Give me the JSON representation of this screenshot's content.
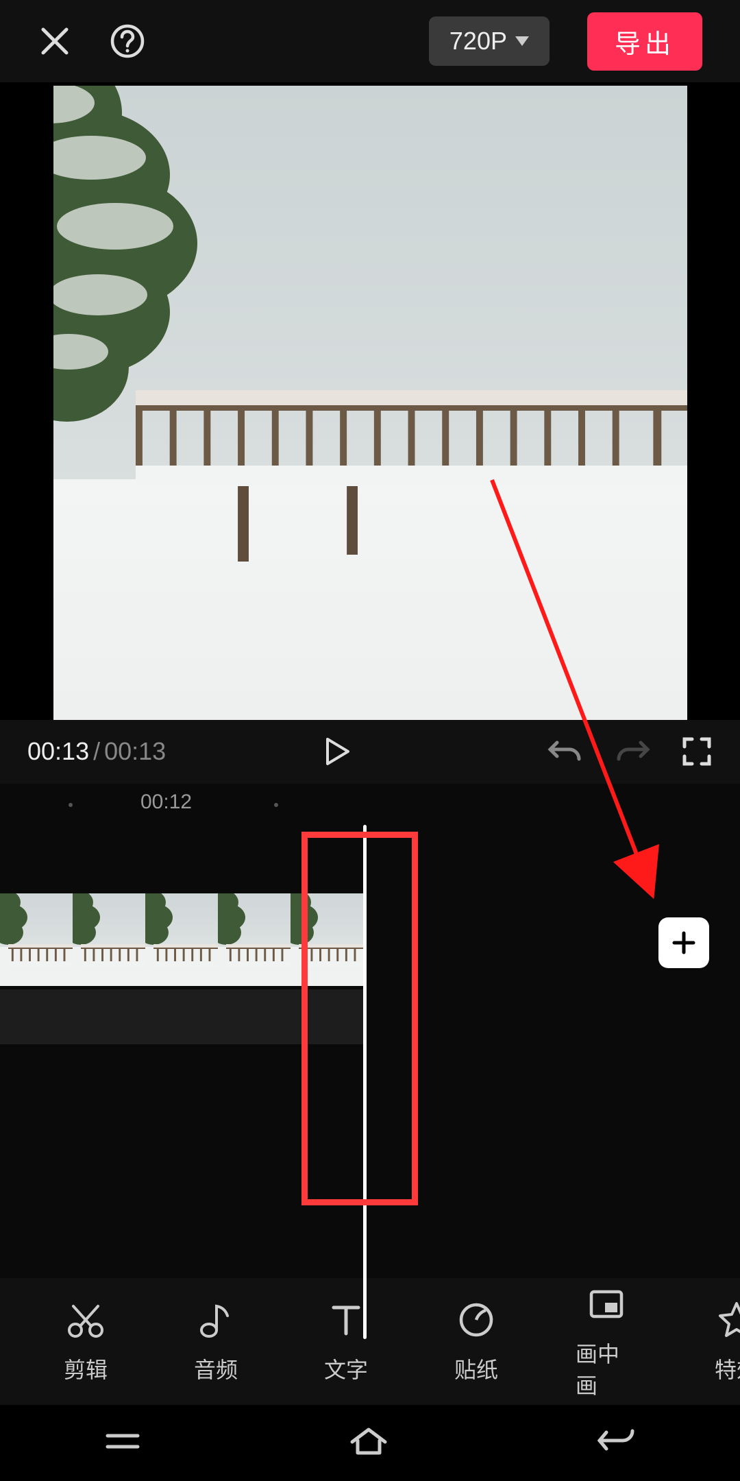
{
  "header": {
    "resolution_label": "720P",
    "export_label": "导出"
  },
  "playbar": {
    "current_time": "00:13",
    "duration": "00:13"
  },
  "timeline": {
    "ruler_label": "00:12"
  },
  "tools": [
    {
      "id": "edit",
      "label": "剪辑"
    },
    {
      "id": "audio",
      "label": "音频"
    },
    {
      "id": "text",
      "label": "文字"
    },
    {
      "id": "sticker",
      "label": "贴纸"
    },
    {
      "id": "pip",
      "label": "画中画"
    },
    {
      "id": "effects",
      "label": "特效"
    }
  ]
}
